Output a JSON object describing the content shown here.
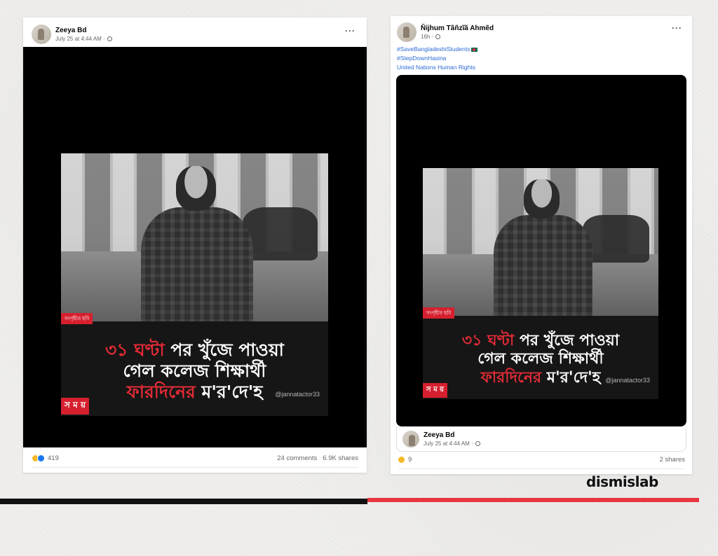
{
  "post_left": {
    "author": "Zeeya Bd",
    "timestamp": "July 25 at 4:44 AM ·",
    "caption_overlay": {
      "source_tag": "সংগৃহীত ছবি",
      "line1_red": "৩১ ঘণ্টা",
      "line1_rest": " পর খুঁজে পাওয়া",
      "line2": "গেল কলেজ শিক্ষার্থী",
      "line3_red": "ফারদিনের",
      "line3_rest": " ম'র'দে'হ",
      "logo": "স ম য়",
      "watermark": "@jannatactor33"
    },
    "reaction_count": "419",
    "comments": "24 comments",
    "shares": "6.9K shares"
  },
  "post_right": {
    "author": "Ñijhum Tãñzĩã Ahmẽd",
    "timestamp": "16h ·",
    "hashtags": [
      "#SaveBangladeshiStudents",
      "#StepDownHasina",
      "United Nations Human Rights"
    ],
    "caption_overlay": {
      "source_tag": "সংগৃহীত ছবি",
      "line1_red": "৩১ ঘণ্টা",
      "line1_rest": " পর খুঁজে পাওয়া",
      "line2": "গেল কলেজ শিক্ষার্থী",
      "line3_red": "ফারদিনের",
      "line3_rest": " ম'র'দে'হ",
      "logo": "স ম য়",
      "watermark": "@jannatactor33"
    },
    "shared_author": "Zeeya Bd",
    "shared_timestamp": "July 25 at 4:44 AM ·",
    "reaction_count": "9",
    "shares": "2 shares"
  },
  "brand": "dismislab",
  "icons": {
    "more": "more-dots-icon",
    "privacy": "globe-icon",
    "reactions": [
      "sad-reaction-icon",
      "like-reaction-icon"
    ]
  },
  "colors": {
    "brand_red": "#e8353e",
    "hashtag_blue": "#2a6ad1",
    "caption_red": "#e32b36"
  }
}
